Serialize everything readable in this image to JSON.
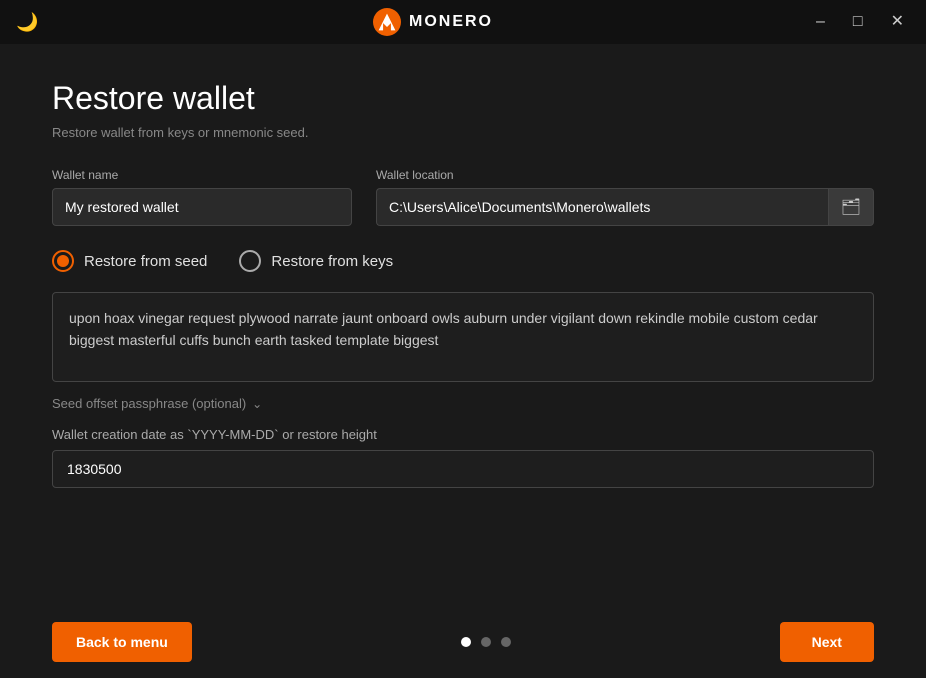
{
  "titlebar": {
    "logo_alt": "Monero logo",
    "title": "MONERO",
    "minimize_label": "minimize",
    "maximize_label": "maximize",
    "close_label": "close"
  },
  "page": {
    "title": "Restore wallet",
    "subtitle": "Restore wallet from keys or mnemonic seed."
  },
  "wallet_name": {
    "label": "Wallet name",
    "value": "My restored wallet",
    "placeholder": "My restored wallet"
  },
  "wallet_location": {
    "label": "Wallet location",
    "value": "C:\\Users\\Alice\\Documents\\Monero\\wallets",
    "placeholder": "C:\\Users\\Alice\\Documents\\Monero\\wallets"
  },
  "restore_options": {
    "from_seed_label": "Restore from seed",
    "from_keys_label": "Restore from keys",
    "selected": "seed"
  },
  "seed": {
    "value": "upon hoax vinegar request plywood narrate jaunt onboard owls auburn under vigilant down rekindle mobile custom cedar biggest masterful cuffs bunch earth tasked template biggest"
  },
  "seed_offset": {
    "label": "Seed offset passphrase (optional)"
  },
  "height": {
    "label": "Wallet creation date as `YYYY-MM-DD` or restore height",
    "value": "1830500",
    "placeholder": "1830500"
  },
  "footer": {
    "back_label": "Back to menu",
    "next_label": "Next",
    "pagination": {
      "dots": [
        "active",
        "inactive",
        "inactive"
      ]
    }
  }
}
